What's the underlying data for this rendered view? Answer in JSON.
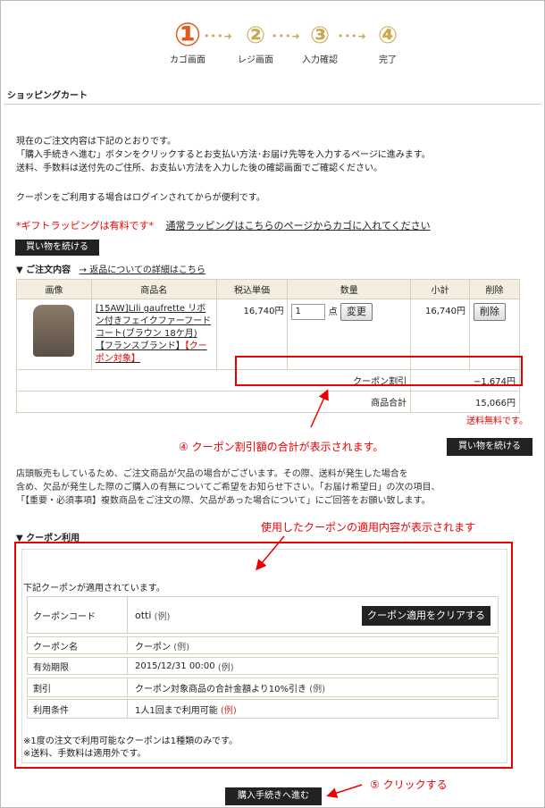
{
  "steps": [
    {
      "num": "①",
      "label": "カゴ画面"
    },
    {
      "num": "②",
      "label": "レジ画面"
    },
    {
      "num": "③",
      "label": "入力確認"
    },
    {
      "num": "④",
      "label": "完了"
    }
  ],
  "step_arrow": "•••➜",
  "section_title": "ショッピングカート",
  "intro": [
    "現在のご注文内容は下記のとおりです。",
    "「購入手続きへ進む」ボタンをクリックするとお支払い方法･お届け先等を入力するページに進みます。",
    "送料、手数料は送付先のご住所、お支払い方法を入力した後の確認画面でご確認ください。"
  ],
  "coupon_login_note": "クーポンをご利用する場合はログインされてからが便利です。",
  "gift": {
    "paid": "*ギフトラッピングは有料です*",
    "link": "通常ラッピングはこちらのページからカゴに入れてください"
  },
  "continue_label": "買い物を続ける",
  "order": {
    "heading": "▼ ご注文内容",
    "link": "→ 返品についての詳細はこちら"
  },
  "cart": {
    "headers": [
      "画像",
      "商品名",
      "税込単価",
      "数量",
      "小計",
      "削除"
    ],
    "item": {
      "name": "[15AW]Lili gaufrette リボン付きフェイクファーフードコート(ブラウン 18ケ月)【フランスブランド】",
      "coupon_tag": "【クーポン対象】",
      "price": "16,740円",
      "qty": "1",
      "qty_unit": "点",
      "change_label": "変更",
      "subtotal": "16,740円",
      "delete_label": "削除"
    },
    "coupon_discount_label": "クーポン割引",
    "coupon_discount_value": "−1,674円",
    "total_label": "商品合計",
    "total_value": "15,066円"
  },
  "free_shipping": "送料無料です。",
  "annotations": {
    "a4": "④ クーポン割引額の合計が表示されます。",
    "used": "使用したクーポンの適用内容が表示されます",
    "a5": "⑤ クリックする"
  },
  "notice": [
    "店頭販売もしているため、ご注文商品が欠品の場合がございます。その際、送料が発生した場合を",
    "含め、欠品が発生した際のご購入の有無についてご希望をお知らせ下さい。「お届け希望日」の次の項目、",
    "「【重要・必須事項】複数商品をご注文の際、欠品があった場合について」にご回答をお願い致します。"
  ],
  "coupon": {
    "heading": "▼ クーポン利用",
    "applied": "下記クーポンが適用されています。",
    "rows": [
      {
        "key": "クーポンコード",
        "value": "otti",
        "ex": "(例)"
      },
      {
        "key": "クーポン名",
        "value": "クーポン",
        "ex": "(例)"
      },
      {
        "key": "有効期限",
        "value": "2015/12/31 00:00",
        "ex": "(例)"
      },
      {
        "key": "割引",
        "value": "クーポン対象商品の合計金額より10%引き",
        "ex": "(例)"
      },
      {
        "key": "利用条件",
        "value": "1人1回まで利用可能",
        "ex": "(例)"
      }
    ],
    "clear_label": "クーポン適用をクリアする",
    "notes": [
      "※1度の注文で利用可能なクーポンは1種類のみです。",
      "※送料、手数料は適用外です。"
    ]
  },
  "purchase_label": "購入手続きへ進む",
  "colors": {
    "accent_orange": "#e2581a",
    "step_gold": "#c9a94c",
    "annotation_red": "#ee0000"
  }
}
